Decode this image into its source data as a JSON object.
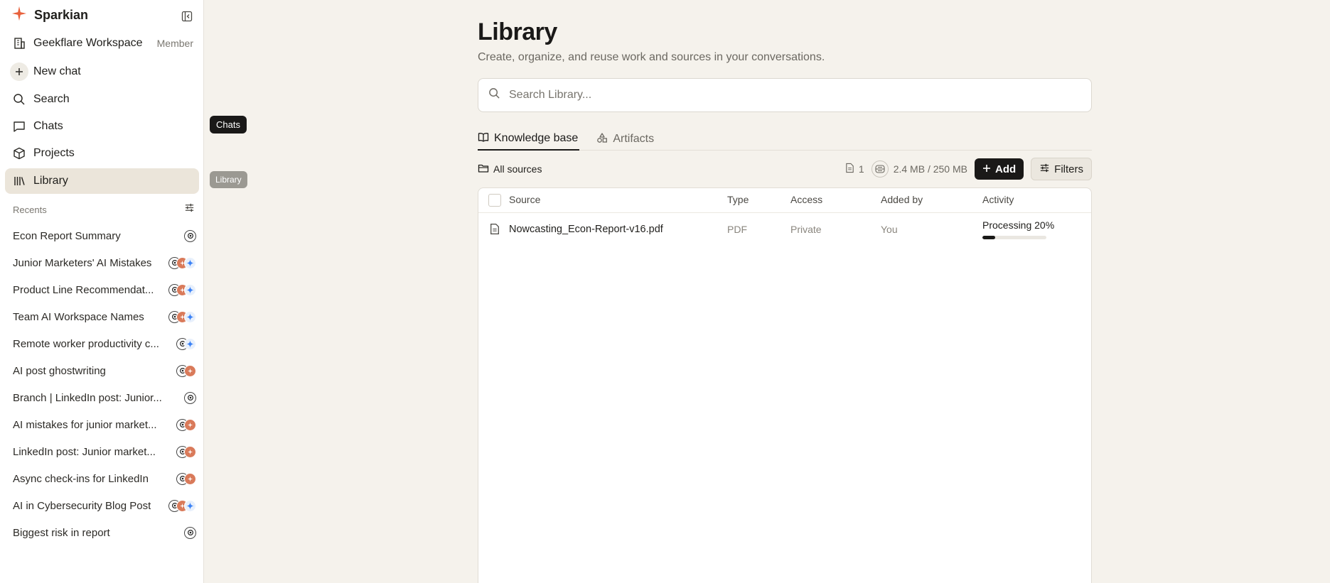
{
  "app": {
    "name": "Sparkian",
    "accent": "#e8613c"
  },
  "workspace": {
    "name": "Geekflare Workspace",
    "role": "Member"
  },
  "nav": {
    "new_chat": "New chat",
    "search": "Search",
    "chats": "Chats",
    "projects": "Projects",
    "library": "Library"
  },
  "recents": {
    "title": "Recents",
    "items": [
      {
        "title": "Econ Report Summary",
        "models": [
          "gpt"
        ]
      },
      {
        "title": "Junior Marketers' AI Mistakes",
        "models": [
          "gpt",
          "claude",
          "gemini"
        ]
      },
      {
        "title": "Product Line Recommendat...",
        "models": [
          "gpt",
          "claude",
          "gemini"
        ]
      },
      {
        "title": "Team AI Workspace Names",
        "models": [
          "gpt",
          "claude",
          "gemini"
        ]
      },
      {
        "title": "Remote worker productivity c...",
        "models": [
          "gpt",
          "gemini"
        ]
      },
      {
        "title": "AI post ghostwriting",
        "models": [
          "gpt",
          "claude"
        ]
      },
      {
        "title": "Branch | LinkedIn post: Junior...",
        "models": [
          "gpt"
        ]
      },
      {
        "title": "AI mistakes for junior market...",
        "models": [
          "gpt",
          "claude"
        ]
      },
      {
        "title": "LinkedIn post: Junior market...",
        "models": [
          "gpt",
          "claude"
        ]
      },
      {
        "title": "Async check-ins for LinkedIn",
        "models": [
          "gpt",
          "claude"
        ]
      },
      {
        "title": "AI in Cybersecurity Blog Post",
        "models": [
          "gpt",
          "claude",
          "gemini"
        ]
      },
      {
        "title": "Biggest risk in report",
        "models": [
          "gpt"
        ]
      }
    ]
  },
  "tooltips": {
    "chats": "Chats",
    "library": "Library"
  },
  "main": {
    "title": "Library",
    "subtitle": "Create, organize, and reuse work and sources in your conversations.",
    "search_placeholder": "Search Library...",
    "tabs": [
      {
        "label": "Knowledge base",
        "active": true
      },
      {
        "label": "Artifacts",
        "active": false
      }
    ],
    "toolbar": {
      "all_sources": "All sources",
      "count": "1",
      "storage": "2.4 MB / 250 MB",
      "add": "Add",
      "filters": "Filters"
    },
    "table": {
      "headers": [
        "Source",
        "Type",
        "Access",
        "Added by",
        "Activity"
      ],
      "rows": [
        {
          "source": "Nowcasting_Econ-Report-v16.pdf",
          "type": "PDF",
          "access": "Private",
          "added_by": "You",
          "activity": "Processing 20%",
          "progress": 0.2
        }
      ]
    }
  }
}
